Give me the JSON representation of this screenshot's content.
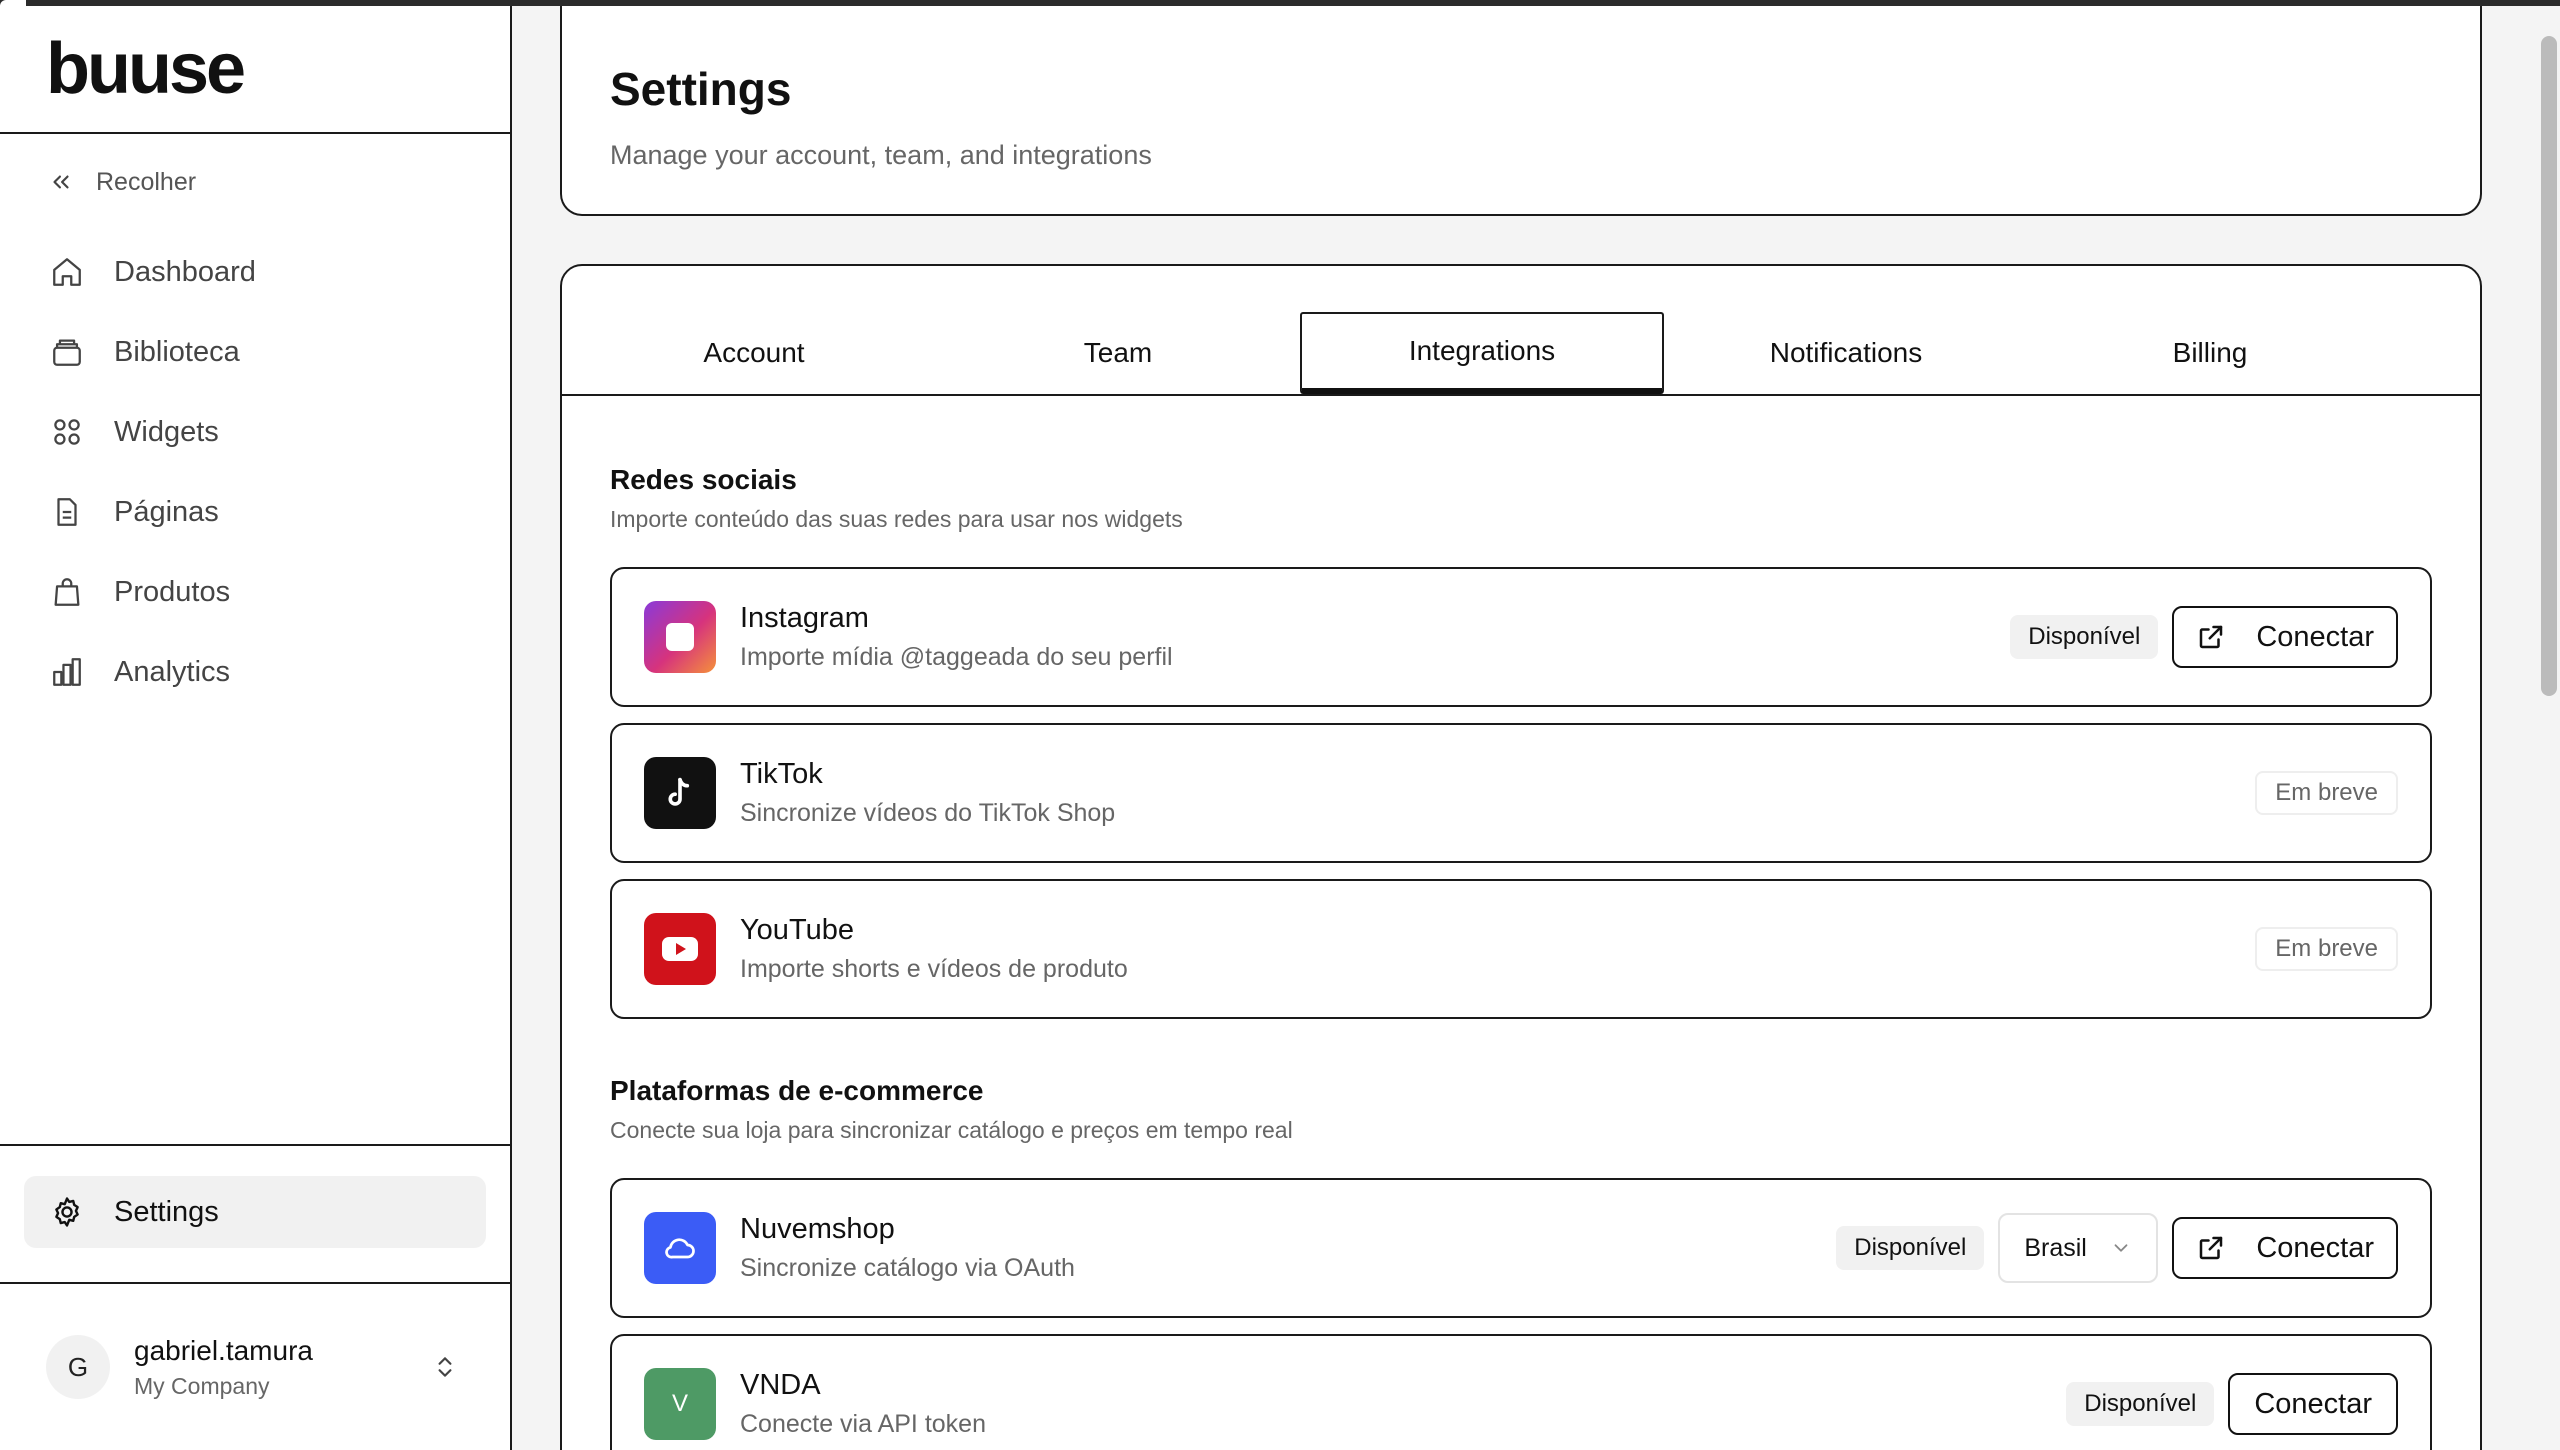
{
  "app": {
    "logo": "buuse"
  },
  "sidebar": {
    "collapse_label": "Recolher",
    "items": [
      {
        "label": "Dashboard",
        "icon": "home-icon"
      },
      {
        "label": "Biblioteca",
        "icon": "library-icon"
      },
      {
        "label": "Widgets",
        "icon": "grid-icon"
      },
      {
        "label": "Páginas",
        "icon": "file-icon"
      },
      {
        "label": "Produtos",
        "icon": "bag-icon"
      },
      {
        "label": "Analytics",
        "icon": "chart-icon"
      }
    ],
    "settings_label": "Settings",
    "user": {
      "initial": "G",
      "name": "gabriel.tamura",
      "company": "My Company"
    }
  },
  "header": {
    "title": "Settings",
    "subtitle": "Manage your account, team, and integrations"
  },
  "tabs": [
    "Account",
    "Team",
    "Integrations",
    "Notifications",
    "Billing"
  ],
  "active_tab": "Integrations",
  "social": {
    "title": "Redes sociais",
    "subtitle": "Importe conteúdo das suas redes para usar nos widgets",
    "items": [
      {
        "name": "Instagram",
        "desc": "Importe mídia @taggeada do seu perfil",
        "status": "Disponível",
        "action": "Conectar"
      },
      {
        "name": "TikTok",
        "desc": "Sincronize vídeos do TikTok Shop",
        "status": "Em breve"
      },
      {
        "name": "YouTube",
        "desc": "Importe shorts e vídeos de produto",
        "status": "Em breve"
      }
    ]
  },
  "ecommerce": {
    "title": "Plataformas de e-commerce",
    "subtitle": "Conecte sua loja para sincronizar catálogo e preços em tempo real",
    "items": [
      {
        "name": "Nuvemshop",
        "desc": "Sincronize catálogo via OAuth",
        "status": "Disponível",
        "region": "Brasil",
        "action": "Conectar"
      },
      {
        "name": "VNDA",
        "icon_letter": "V",
        "desc": "Conecte via API token",
        "status": "Disponível",
        "action": "Conectar"
      }
    ]
  },
  "colors": {
    "instagram": "#d6337d",
    "tiktok": "#111111",
    "youtube": "#d0121b",
    "nuvemshop": "#3b5cf6",
    "vnda": "#4e9a65"
  }
}
